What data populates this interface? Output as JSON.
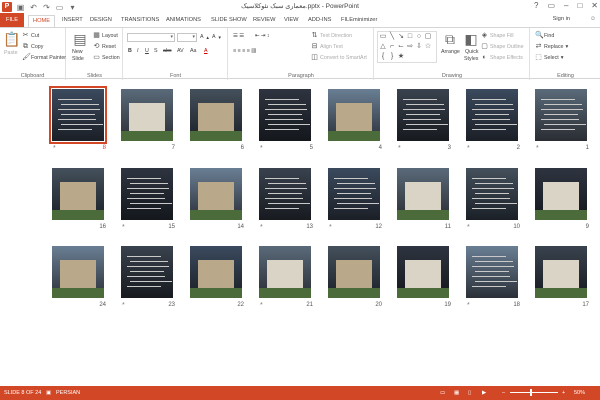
{
  "titlebar": {
    "title": "معماری سبک نئوکلاسیک.pptx - PowerPoint",
    "logo": "P",
    "qat_icons": [
      "save-icon",
      "undo-icon",
      "redo-icon",
      "present-icon"
    ],
    "window_icons": [
      "help-icon",
      "ribbon-display-icon",
      "minimize-icon",
      "maximize-icon",
      "close-icon"
    ]
  },
  "tabs": [
    "FILE",
    "HOME",
    "INSERT",
    "DESIGN",
    "TRANSITIONS",
    "ANIMATIONS",
    "SLIDE SHOW",
    "REVIEW",
    "VIEW",
    "ADD-INS",
    "FILEminimizer"
  ],
  "active_tab": "HOME",
  "signin": "Sign in",
  "ribbon": {
    "clipboard": {
      "label": "Clipboard",
      "paste": "Paste",
      "cut": "Cut",
      "copy": "Copy",
      "format_painter": "Format Painter"
    },
    "slides": {
      "label": "Slides",
      "new_slide": "New",
      "new_slide2": "Slide",
      "layout": "Layout",
      "reset": "Reset",
      "section": "Section"
    },
    "font": {
      "label": "Font",
      "bold": "B",
      "italic": "I",
      "underline": "U",
      "shadow": "S",
      "strike": "abc",
      "spacing": "AV",
      "case": "Aa",
      "color": "A"
    },
    "paragraph": {
      "label": "Paragraph",
      "text_direction": "Text Direction",
      "align_text": "Align Text",
      "smartart": "Convert to SmartArt"
    },
    "drawing": {
      "label": "Drawing",
      "arrange": "Arrange",
      "quick_styles": "Quick",
      "quick_styles2": "Styles",
      "shape_fill": "Shape Fill",
      "shape_outline": "Shape Outline",
      "shape_effects": "Shape Effects"
    },
    "editing": {
      "label": "Editing",
      "find": "Find",
      "replace": "Replace",
      "select": "Select"
    }
  },
  "slides": [
    {
      "n": "8",
      "star": "*",
      "selected": true
    },
    {
      "n": "7",
      "star": ""
    },
    {
      "n": "6",
      "star": ""
    },
    {
      "n": "5",
      "star": "*"
    },
    {
      "n": "4",
      "star": ""
    },
    {
      "n": "3",
      "star": "*"
    },
    {
      "n": "2",
      "star": "*"
    },
    {
      "n": "1",
      "star": "*"
    },
    {
      "n": "16",
      "star": ""
    },
    {
      "n": "15",
      "star": "*"
    },
    {
      "n": "14",
      "star": ""
    },
    {
      "n": "13",
      "star": "*"
    },
    {
      "n": "12",
      "star": "*"
    },
    {
      "n": "11",
      "star": ""
    },
    {
      "n": "10",
      "star": "*"
    },
    {
      "n": "9",
      "star": ""
    },
    {
      "n": "24",
      "star": ""
    },
    {
      "n": "23",
      "star": "*"
    },
    {
      "n": "22",
      "star": ""
    },
    {
      "n": "21",
      "star": "*"
    },
    {
      "n": "20",
      "star": ""
    },
    {
      "n": "19",
      "star": ""
    },
    {
      "n": "18",
      "star": "*"
    },
    {
      "n": "17",
      "star": ""
    }
  ],
  "status": {
    "slide_info": "SLIDE 8 OF 24",
    "language": "PERSIAN",
    "zoom": "50%"
  },
  "colors": {
    "accent": "#d24726"
  }
}
